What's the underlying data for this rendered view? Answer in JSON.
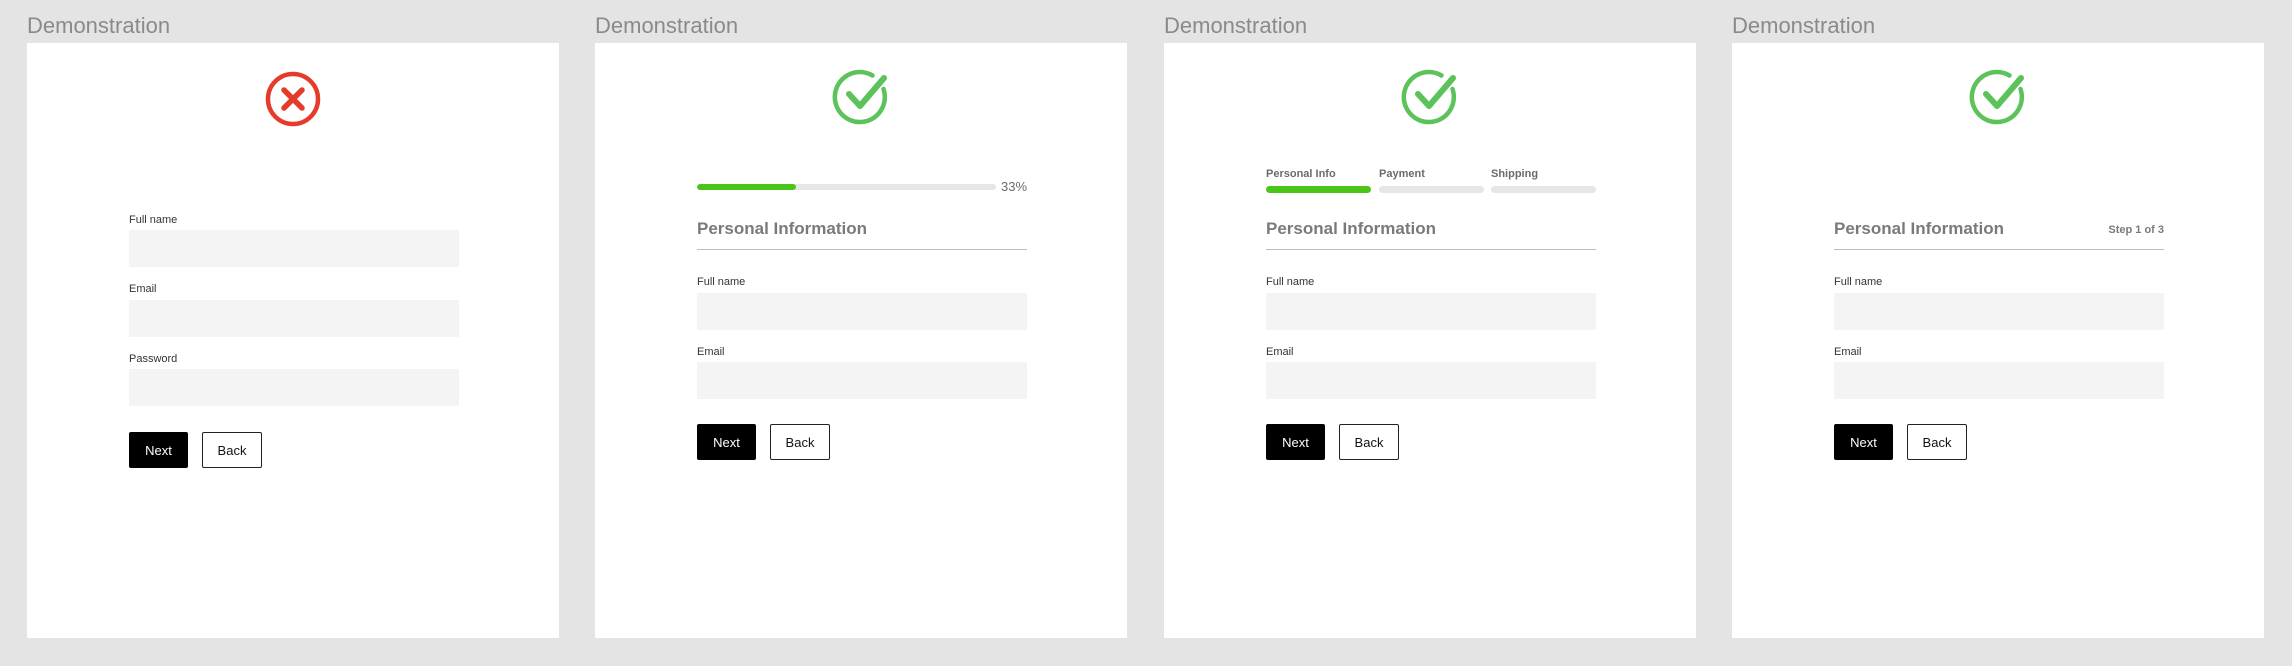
{
  "colors": {
    "background": "#e4e4e4",
    "card": "#ffffff",
    "error": "#e53b2a",
    "success": "#5cc25a",
    "progress": "#4cc51a",
    "button_primary": "#000000"
  },
  "panels": [
    {
      "caption": "Demonstration",
      "status_icon": "error-x-circle-icon",
      "fields": [
        {
          "label": "Full name",
          "value": "",
          "placeholder": ""
        },
        {
          "label": "Email",
          "value": "",
          "placeholder": ""
        },
        {
          "label": "Password",
          "value": "",
          "placeholder": ""
        }
      ],
      "buttons": {
        "next": "Next",
        "back": "Back"
      }
    },
    {
      "caption": "Demonstration",
      "status_icon": "success-check-circle-icon",
      "progress": {
        "value": 0.33,
        "label": "33%"
      },
      "section_title": "Personal Information",
      "fields": [
        {
          "label": "Full name",
          "value": "",
          "placeholder": ""
        },
        {
          "label": "Email",
          "value": "",
          "placeholder": ""
        }
      ],
      "buttons": {
        "next": "Next",
        "back": "Back"
      }
    },
    {
      "caption": "Demonstration",
      "status_icon": "success-check-circle-icon",
      "steps": [
        {
          "label": "Personal Info",
          "active": true
        },
        {
          "label": "Payment",
          "active": false
        },
        {
          "label": "Shipping",
          "active": false
        }
      ],
      "section_title": "Personal Information",
      "fields": [
        {
          "label": "Full name",
          "value": "",
          "placeholder": ""
        },
        {
          "label": "Email",
          "value": "",
          "placeholder": ""
        }
      ],
      "buttons": {
        "next": "Next",
        "back": "Back"
      }
    },
    {
      "caption": "Demonstration",
      "status_icon": "success-check-circle-icon",
      "section_title": "Personal Information",
      "step_counter": "Step 1 of 3",
      "fields": [
        {
          "label": "Full name",
          "value": "",
          "placeholder": ""
        },
        {
          "label": "Email",
          "value": "",
          "placeholder": ""
        }
      ],
      "buttons": {
        "next": "Next",
        "back": "Back"
      }
    }
  ]
}
